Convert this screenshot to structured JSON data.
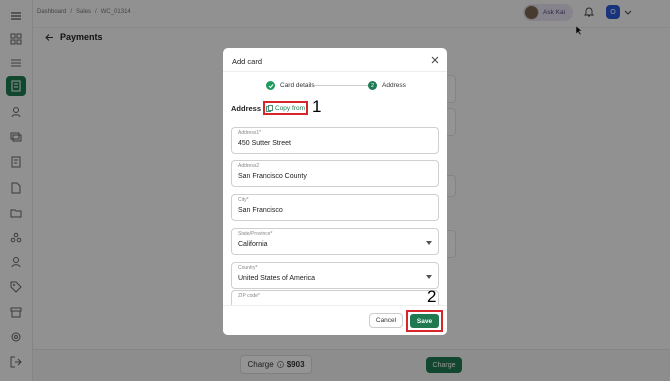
{
  "breadcrumb": [
    "Dashboard",
    "/",
    "Sales",
    "/",
    "WC_01314"
  ],
  "topbar": {
    "ask_label": "Ask Kai",
    "user_initial": "O"
  },
  "page": {
    "title": "Payments"
  },
  "bottom": {
    "charge_total_label": "Charge",
    "charge_total_amount": "$903",
    "charge_button": "Charge"
  },
  "background": {
    "link_fragment": "d"
  },
  "modal": {
    "title": "Add card",
    "steps": [
      {
        "label": "Card details",
        "state": "done"
      },
      {
        "label": "Address",
        "number": "2",
        "state": "current"
      }
    ],
    "section_label": "Address",
    "copy_from_label": "Copy from",
    "fields": [
      {
        "label": "Address1*",
        "value": "450 Sutter Street",
        "type": "text"
      },
      {
        "label": "Address2",
        "value": "San Francisco County",
        "type": "text"
      },
      {
        "label": "City*",
        "value": "San Francisco",
        "type": "text"
      },
      {
        "label": "State/Province*",
        "value": "California",
        "type": "select"
      },
      {
        "label": "Country*",
        "value": "United States of America",
        "type": "select"
      },
      {
        "label": "ZIP code*",
        "value": "",
        "type": "text"
      }
    ],
    "cancel_label": "Cancel",
    "save_label": "Save"
  },
  "annotations": {
    "one": "1",
    "two": "2"
  },
  "colors": {
    "accent": "#1f7a52",
    "highlight": "#d6262b",
    "overlay": "rgba(0,0,0,0.42)"
  }
}
